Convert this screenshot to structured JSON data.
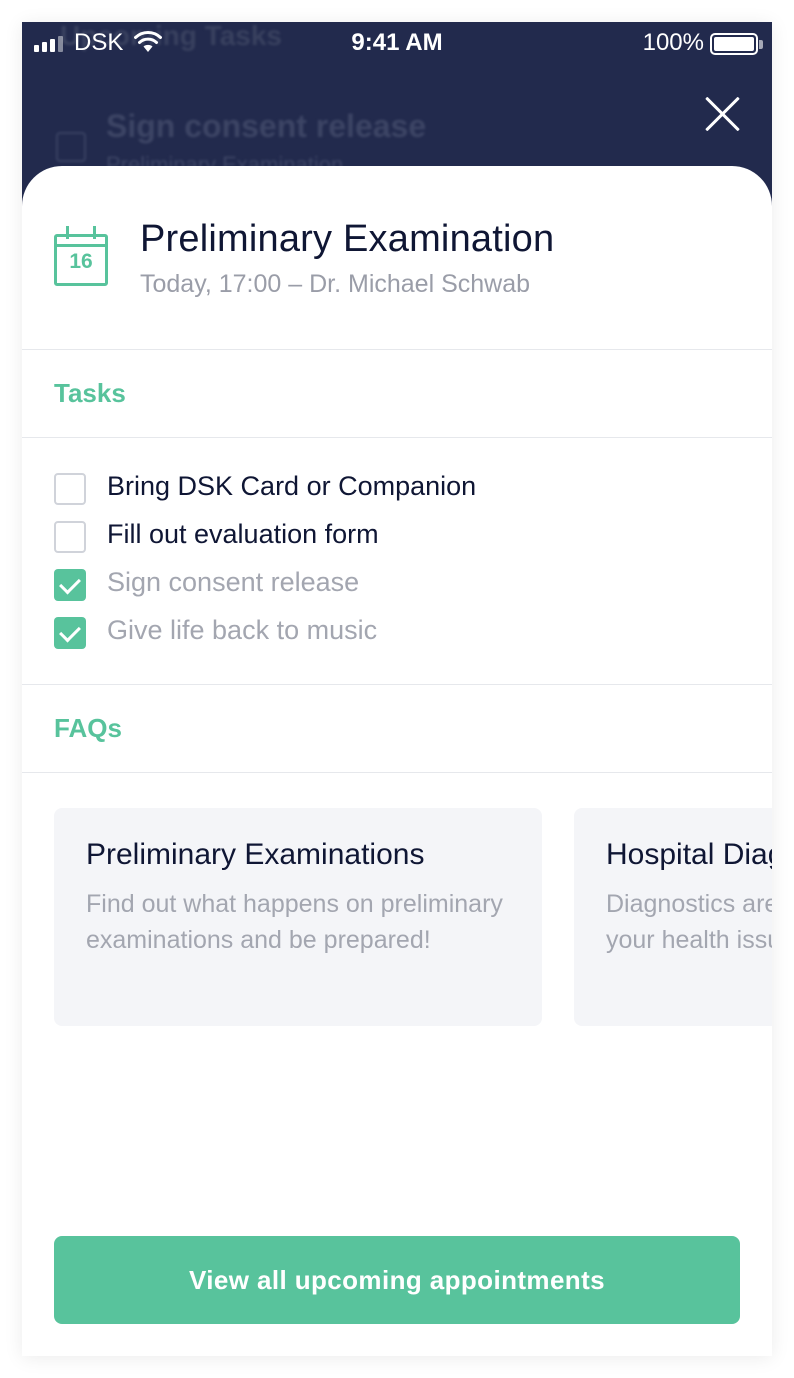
{
  "status_bar": {
    "carrier": "DSK",
    "time": "9:41 AM",
    "battery": "100%"
  },
  "background": {
    "title": "Upcoming Tasks",
    "task": "Sign consent release",
    "task_sub": "Preliminary Examination"
  },
  "appointment": {
    "calendar_day": "16",
    "title": "Preliminary Examination",
    "subtitle": "Today, 17:00 – Dr. Michael Schwab"
  },
  "tasks": {
    "heading": "Tasks",
    "items": [
      {
        "label": "Bring DSK Card or Companion",
        "checked": false
      },
      {
        "label": "Fill out evaluation form",
        "checked": false
      },
      {
        "label": "Sign consent release",
        "checked": true
      },
      {
        "label": "Give life back to music",
        "checked": true
      }
    ]
  },
  "faqs": {
    "heading": "FAQs",
    "cards": [
      {
        "title": "Preliminary Examinations",
        "description": "Find out what happens on preliminary examinations and be prepared!"
      },
      {
        "title": "Hospital Diagnostics",
        "description": "Diagnostics are a good way to know your health issues. Find out more"
      }
    ]
  },
  "cta": {
    "label": "View all upcoming appointments"
  },
  "colors": {
    "accent": "#58c39c",
    "header_bg": "#222a4d",
    "text_primary": "#0f1634",
    "text_muted": "#a3a6b0"
  }
}
